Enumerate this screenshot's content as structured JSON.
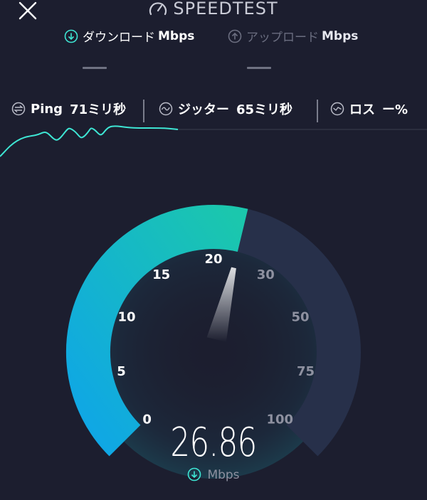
{
  "header": {
    "title": "SPEEDTEST",
    "close_icon": "close-icon",
    "gauge_icon": "speedometer-icon"
  },
  "tabs": {
    "download": {
      "label": "ダウンロード",
      "unit": "Mbps",
      "icon": "download-arrow-icon",
      "value": "—"
    },
    "upload": {
      "label": "アップロード",
      "unit": "Mbps",
      "icon": "upload-arrow-icon",
      "value": "—"
    }
  },
  "metrics": {
    "ping": {
      "label": "Ping",
      "value": "71ミリ秒",
      "icon": "ping-icon"
    },
    "jitter": {
      "label": "ジッター",
      "value": "65ミリ秒",
      "icon": "jitter-icon"
    },
    "loss": {
      "label": "ロス",
      "value": "ー%",
      "icon": "loss-icon"
    }
  },
  "gauge": {
    "ticks": [
      "0",
      "5",
      "10",
      "15",
      "20",
      "30",
      "50",
      "75",
      "100"
    ],
    "current_value": "26.86",
    "unit": "Mbps",
    "unit_icon": "download-arrow-icon",
    "fill_fraction": 0.55
  },
  "colors": {
    "background": "#1c1e2f",
    "accent_start": "#0fa6e6",
    "accent_end": "#1bc7ad",
    "track": "#27304a",
    "graph_line": "#3ee6d4"
  }
}
